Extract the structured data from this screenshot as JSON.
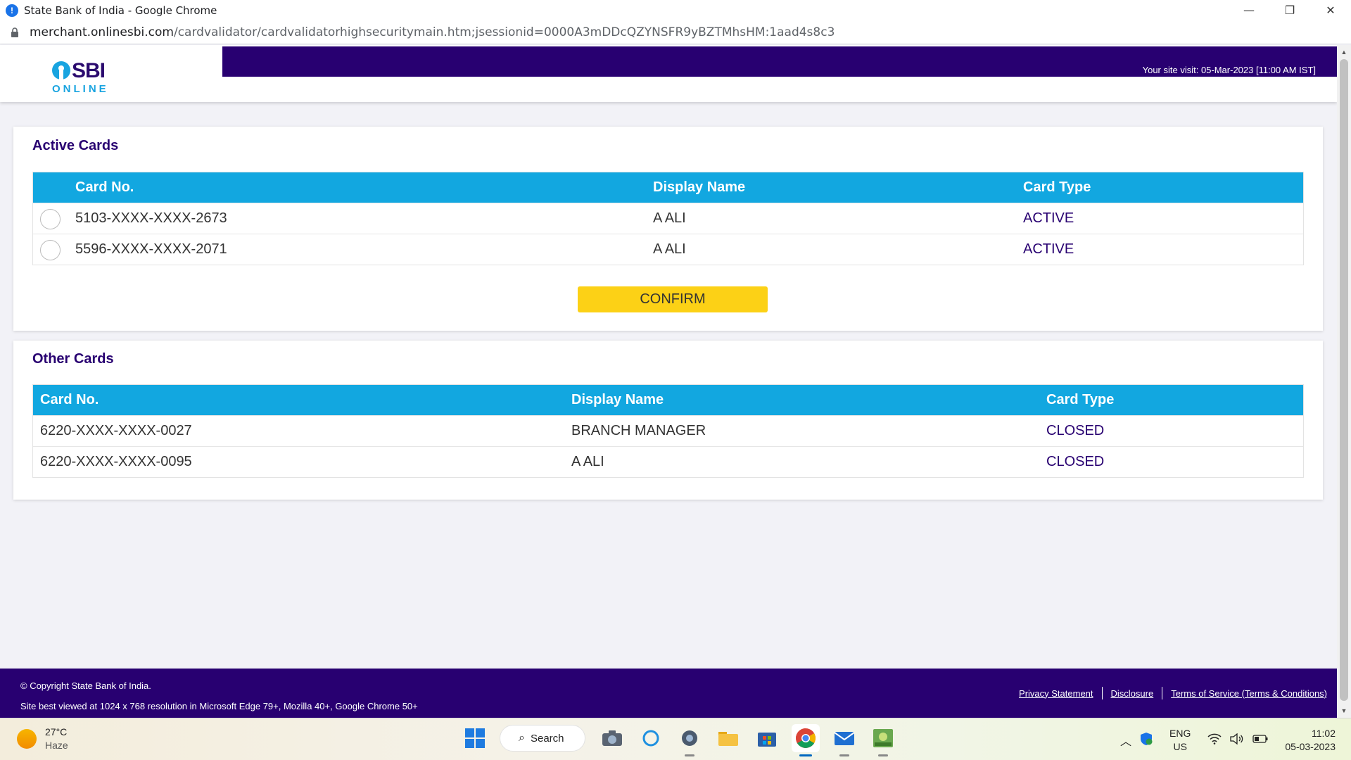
{
  "browser": {
    "tab_title": "State Bank of India - Google Chrome",
    "url_host": "merchant.onlinesbi.com",
    "url_path": "/cardvalidator/cardvalidatorhighsecuritymain.htm;jsessionid=0000A3mDDcQZYNSFR9yBZTMhsHM:1aad4s8c3",
    "controls": {
      "minimize": "—",
      "restore": "❐",
      "close": "✕"
    }
  },
  "header": {
    "logo_sbi": "SBI",
    "logo_online": "ONLINE",
    "site_visit": "Your site visit: 05-Mar-2023 [11:00 AM IST]"
  },
  "active_cards": {
    "title": "Active Cards",
    "columns": [
      "Card No.",
      "Display Name",
      "Card Type"
    ],
    "rows": [
      {
        "card_no": "5103-XXXX-XXXX-2673",
        "display_name": "A ALI",
        "card_type": "ACTIVE"
      },
      {
        "card_no": "5596-XXXX-XXXX-2071",
        "display_name": "A ALI",
        "card_type": "ACTIVE"
      }
    ],
    "confirm_label": "CONFIRM"
  },
  "other_cards": {
    "title": "Other Cards",
    "columns": [
      "Card No.",
      "Display Name",
      "Card Type"
    ],
    "rows": [
      {
        "card_no": "6220-XXXX-XXXX-0027",
        "display_name": "BRANCH MANAGER",
        "card_type": "CLOSED"
      },
      {
        "card_no": "6220-XXXX-XXXX-0095",
        "display_name": "A ALI",
        "card_type": "CLOSED"
      }
    ]
  },
  "footer": {
    "copyright": "© Copyright State Bank of India.",
    "best_viewed": "Site best viewed at 1024 x 768 resolution in Microsoft Edge 79+, Mozilla 40+, Google Chrome 50+",
    "links": [
      "Privacy Statement",
      "Disclosure",
      "Terms of Service (Terms & Conditions)"
    ]
  },
  "taskbar": {
    "weather_temp": "27°C",
    "weather_desc": "Haze",
    "search_label": "Search",
    "lang_top": "ENG",
    "lang_bottom": "US",
    "time": "11:02",
    "date": "05-03-2023"
  },
  "colors": {
    "brand_purple": "#280071",
    "table_header_blue": "#12a7e0",
    "confirm_yellow": "#fcd116"
  }
}
